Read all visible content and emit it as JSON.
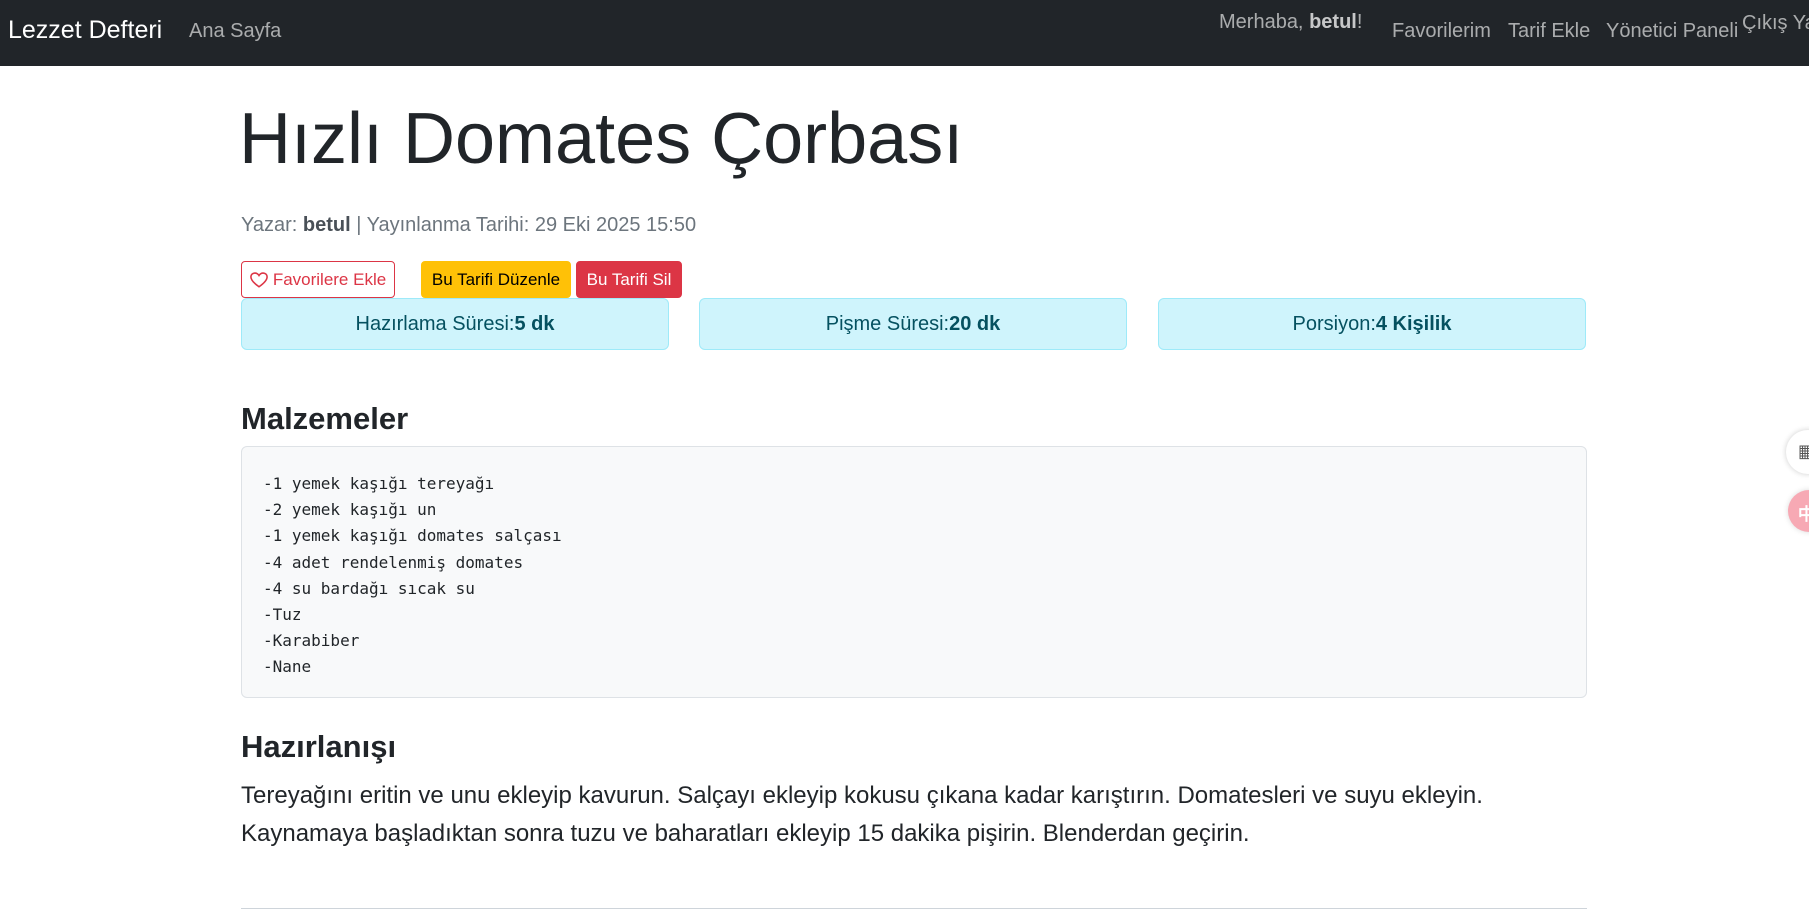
{
  "navbar": {
    "brand": "Lezzet Defteri",
    "home": "Ana Sayfa",
    "greeting_prefix": "Merhaba, ",
    "greeting_user": "betul",
    "greeting_suffix": "!",
    "favorites": "Favorilerim",
    "add_recipe": "Tarif Ekle",
    "admin_panel": "Yönetici Paneli",
    "logout": "Çıkış Ya"
  },
  "recipe": {
    "title": "Hızlı Domates Çorbası",
    "author_label": "Yazar: ",
    "author": "betul",
    "published_label": " | Yayınlanma Tarihi: 29 Eki 2025 15:50",
    "actions": {
      "favorite": "Favorilere Ekle",
      "edit": "Bu Tarifi Düzenle",
      "delete": "Bu Tarifi Sil"
    },
    "info": {
      "prep_label": "Hazırlama Süresi: ",
      "prep_value": "5 dk",
      "cook_label": "Pişme Süresi: ",
      "cook_value": "20 dk",
      "serving_label": "Porsiyon: ",
      "serving_value": "4 Kişilik"
    },
    "ingredients_heading": "Malzemeler",
    "ingredients": [
      "-1 yemek kaşığı tereyağı",
      "-2 yemek kaşığı un",
      "-1 yemek kaşığı domates salçası",
      "-4 adet rendelenmiş domates",
      "-4 su bardağı sıcak su",
      "-Tuz",
      "-Karabiber",
      "-Nane"
    ],
    "preparation_heading": "Hazırlanışı",
    "preparation": "Tereyağını eritin ve unu ekleyip kavurun. Salçayı ekleyip kokusu çıkana kadar karıştırın. Domatesleri ve suyu ekleyin. Kaynamaya başladıktan sonra tuzu ve baharatları ekleyip 15 dakika pişirin. Blenderdan geçirin."
  },
  "colors": {
    "navbar_bg": "#212529",
    "danger": "#dc3545",
    "warning": "#ffc107",
    "info_bg": "#cff4fc",
    "info_text": "#055160"
  },
  "icons": {
    "favorite": "heart-outline-icon",
    "side_widget_1": "grid-icon",
    "side_widget_2": "translate-icon"
  },
  "side_widget_glyph": "中"
}
